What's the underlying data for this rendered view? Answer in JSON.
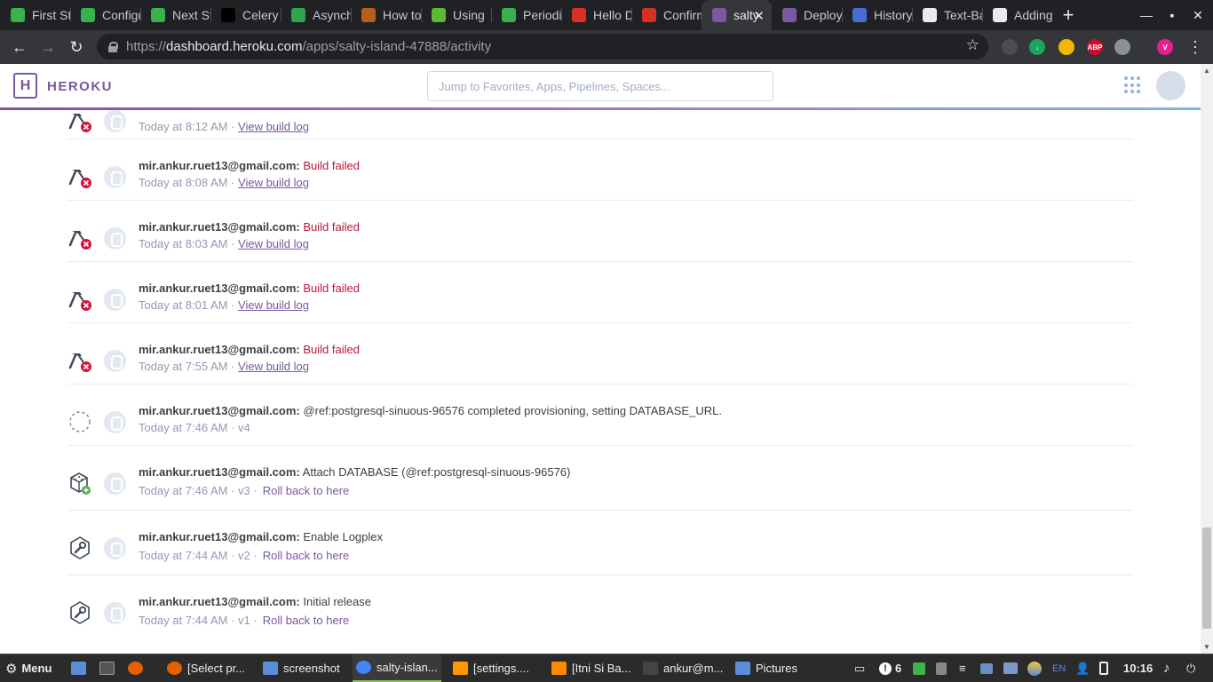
{
  "browser": {
    "tabs": [
      {
        "title": "First Steps",
        "favicon": "celery-icon",
        "color": "#37b24d"
      },
      {
        "title": "Configuration",
        "favicon": "celery-icon",
        "color": "#37b24d"
      },
      {
        "title": "Next Steps",
        "favicon": "celery-icon",
        "color": "#37b24d"
      },
      {
        "title": "Celery",
        "favicon": "medium-icon",
        "color": "#000000"
      },
      {
        "title": "Asynchronous",
        "favicon": "github-octocat-icon",
        "color": "#2ea44f"
      },
      {
        "title": "How to",
        "favicon": "web-icon",
        "color": "#b95d1f"
      },
      {
        "title": "Using",
        "favicon": "spring-leaf-icon",
        "color": "#5fb832"
      },
      {
        "title": "Periodic",
        "favicon": "celery-icon",
        "color": "#37b24d"
      },
      {
        "title": "Hello Django",
        "favicon": "gmail-icon",
        "color": "#d93025"
      },
      {
        "title": "Confirm",
        "favicon": "gmail-icon",
        "color": "#d93025"
      },
      {
        "title": "salty-island",
        "favicon": "heroku-icon",
        "color": "#79589f"
      },
      {
        "title": "Deploy",
        "favicon": "heroku-icon",
        "color": "#79589f"
      },
      {
        "title": "History",
        "favicon": "history-icon",
        "color": "#4a6cd4"
      },
      {
        "title": "Text-Based",
        "favicon": "github-icon",
        "color": "#e8eaed"
      },
      {
        "title": "Adding",
        "favicon": "github-icon",
        "color": "#e8eaed"
      }
    ],
    "active_tab": 10,
    "new_tab_label": "+",
    "close_label": "✕",
    "url_prefix": "https://",
    "url_host": "dashboard.heroku.com",
    "url_path": "/apps/salty-island-47888/activity",
    "extensions": [
      {
        "name": "extension-gray-icon",
        "label": "",
        "color": "#4a4c50"
      },
      {
        "name": "extension-green-icon",
        "label": "↓",
        "color": "#1ea362"
      },
      {
        "name": "bulb-icon",
        "label": "",
        "color": "#f2b705"
      },
      {
        "name": "adblock-plus-icon",
        "label": "ABP",
        "color": "#c70d2c"
      },
      {
        "name": "shield-icon",
        "label": "",
        "color": "#8a8f98"
      },
      {
        "name": "profile-icon",
        "label": "V",
        "color": "#e91e8c"
      }
    ]
  },
  "heroku": {
    "brand": "HEROKU",
    "logo_letter": "H",
    "search_placeholder": "Jump to Favorites, Apps, Pipelines, Spaces..."
  },
  "activity": [
    {
      "icon": "build-failed-icon",
      "user": "",
      "message": "",
      "failed": false,
      "time": "Today at 8:12 AM",
      "meta": "",
      "link": "View build log",
      "rollback": ""
    },
    {
      "icon": "build-failed-icon",
      "user": "mir.ankur.ruet13@gmail.com:",
      "message": "Build failed",
      "failed": true,
      "time": "Today at 8:08 AM",
      "meta": "",
      "link": "View build log",
      "rollback": ""
    },
    {
      "icon": "build-failed-icon",
      "user": "mir.ankur.ruet13@gmail.com:",
      "message": "Build failed",
      "failed": true,
      "time": "Today at 8:03 AM",
      "meta": "",
      "link": "View build log",
      "rollback": ""
    },
    {
      "icon": "build-failed-icon",
      "user": "mir.ankur.ruet13@gmail.com:",
      "message": "Build failed",
      "failed": true,
      "time": "Today at 8:01 AM",
      "meta": "",
      "link": "View build log",
      "rollback": ""
    },
    {
      "icon": "build-failed-icon",
      "user": "mir.ankur.ruet13@gmail.com:",
      "message": "Build failed",
      "failed": true,
      "time": "Today at 7:55 AM",
      "meta": "",
      "link": "View build log",
      "rollback": ""
    },
    {
      "icon": "provisioning-icon",
      "user": "mir.ankur.ruet13@gmail.com:",
      "message": "@ref:postgresql-sinuous-96576 completed provisioning, setting DATABASE_URL.",
      "failed": false,
      "time": "Today at 7:46 AM",
      "meta": "v4",
      "link": "",
      "rollback": ""
    },
    {
      "icon": "add-database-icon",
      "user": "mir.ankur.ruet13@gmail.com:",
      "message": "Attach DATABASE (@ref:postgresql-sinuous-96576)",
      "failed": false,
      "time": "Today at 7:46 AM",
      "meta": "v3",
      "link": "",
      "rollback": "Roll back to here"
    },
    {
      "icon": "wrench-icon",
      "user": "mir.ankur.ruet13@gmail.com:",
      "message": "Enable Logplex",
      "failed": false,
      "time": "Today at 7:44 AM",
      "meta": "v2",
      "link": "",
      "rollback": "Roll back to here"
    },
    {
      "icon": "wrench-icon",
      "user": "mir.ankur.ruet13@gmail.com:",
      "message": "Initial release",
      "failed": false,
      "time": "Today at 7:44 AM",
      "meta": "v1",
      "link": "",
      "rollback": "Roll back to here"
    }
  ],
  "taskbar": {
    "menu_label": "Menu",
    "windows": [
      {
        "label": "[Select pr...",
        "icon": "firefox-icon",
        "color": "#e66000"
      },
      {
        "label": "screenshot",
        "icon": "folder-icon",
        "color": "#5b8dd6"
      },
      {
        "label": "salty-islan...",
        "icon": "chrome-icon",
        "color": "#4285f4"
      },
      {
        "label": "[settings....",
        "icon": "sublime-icon",
        "color": "#ff9800"
      },
      {
        "label": "[Itni Si Ba...",
        "icon": "vlc-icon",
        "color": "#ff8800"
      },
      {
        "label": "ankur@m...",
        "icon": "terminal-icon",
        "color": "#444444"
      },
      {
        "label": "Pictures",
        "icon": "folder-icon",
        "color": "#5b8dd6"
      }
    ],
    "active_window": 2,
    "notification_count": "6",
    "language": "EN",
    "clock": "10:16"
  }
}
